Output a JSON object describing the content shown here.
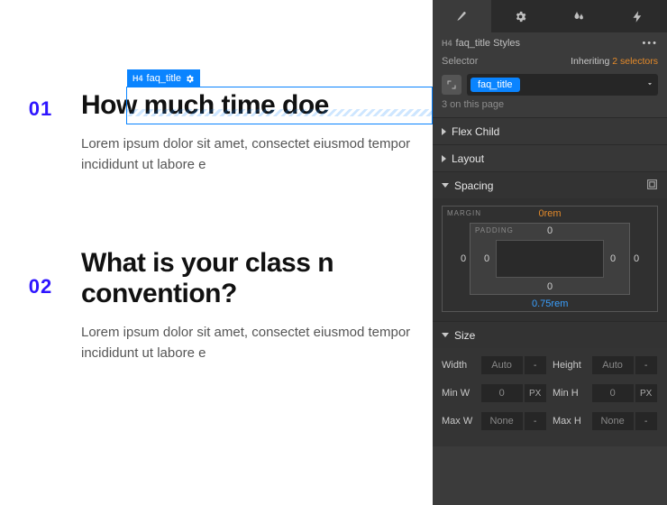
{
  "canvas": {
    "selected": {
      "tag": "faq_title"
    },
    "faqs": [
      {
        "num": "01",
        "title": "How much time doe",
        "body": "Lorem ipsum dolor sit amet, consectet​ eiusmod tempor incididunt ut labore e"
      },
      {
        "num": "02",
        "title": "What is your class n\nconvention?",
        "body": "Lorem ipsum dolor sit amet, consectet eiusmod tempor incididunt ut labore e"
      }
    ]
  },
  "panel": {
    "crumb": {
      "h4": "H4",
      "name": "faq_title Styles"
    },
    "selector": {
      "label": "Selector",
      "inheriting_label": "Inheriting",
      "inheriting_count": "2 selectors",
      "chip": "faq_title",
      "onpage": "3 on this page"
    },
    "sections": {
      "flex_child": "Flex Child",
      "layout": "Layout",
      "spacing": "Spacing",
      "size": "Size"
    },
    "spacing": {
      "margin_label": "MARGIN",
      "padding_label": "PADDING",
      "margin": {
        "top": "0rem",
        "right": "0",
        "bottom": "0.75rem",
        "left": "0"
      },
      "padding": {
        "top": "0",
        "right": "0",
        "bottom": "0",
        "left": "0"
      }
    },
    "size": {
      "width_label": "Width",
      "width_val": "Auto",
      "width_unit": "-",
      "height_label": "Height",
      "height_val": "Auto",
      "height_unit": "-",
      "minw_label": "Min W",
      "minw_val": "0",
      "minw_unit": "PX",
      "minh_label": "Min H",
      "minh_val": "0",
      "minh_unit": "PX",
      "maxw_label": "Max W",
      "maxw_val": "None",
      "maxw_unit": "-",
      "maxh_label": "Max H",
      "maxh_val": "None",
      "maxh_unit": "-"
    }
  }
}
